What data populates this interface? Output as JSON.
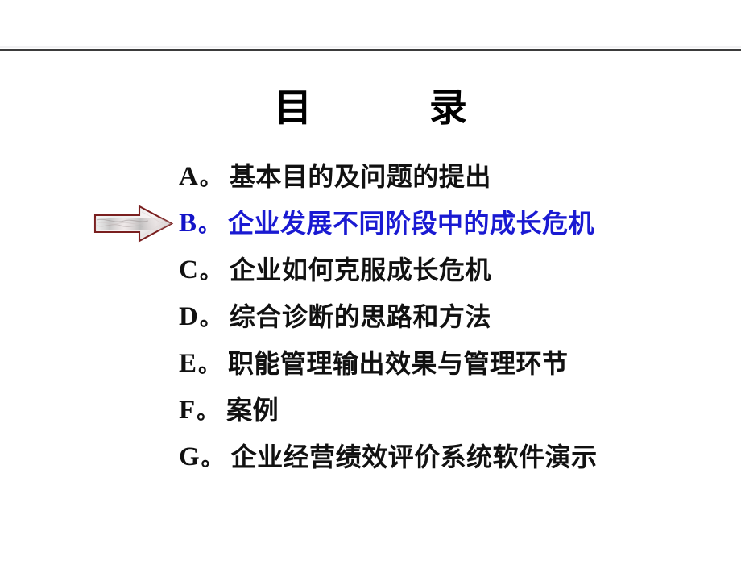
{
  "slide": {
    "title": "目    录",
    "divider": true,
    "background_color": "#ffffff",
    "highlight_color": "#1a1ad2",
    "body_text_color": "#111111",
    "arrow": {
      "icon_name": "right-block-arrow-icon",
      "outline_color": "#7a1f1f",
      "fill_color": "#f2eeee",
      "points_to": "B"
    },
    "items": [
      {
        "letter": "A",
        "separator": "。",
        "text": "基本目的及问题的提出",
        "current": false
      },
      {
        "letter": "B",
        "separator": "。",
        "text": "企业发展不同阶段中的成长危机",
        "current": true
      },
      {
        "letter": "C",
        "separator": "。",
        "text": "企业如何克服成长危机",
        "current": false
      },
      {
        "letter": "D",
        "separator": "。",
        "text": "综合诊断的思路和方法",
        "current": false
      },
      {
        "letter": "E",
        "separator": "。",
        "text": "职能管理输出效果与管理环节",
        "current": false
      },
      {
        "letter": "F",
        "separator": "。",
        "text": "案例",
        "current": false
      },
      {
        "letter": "G",
        "separator": "。",
        "text": "企业经营绩效评价系统软件演示",
        "current": false
      }
    ]
  }
}
